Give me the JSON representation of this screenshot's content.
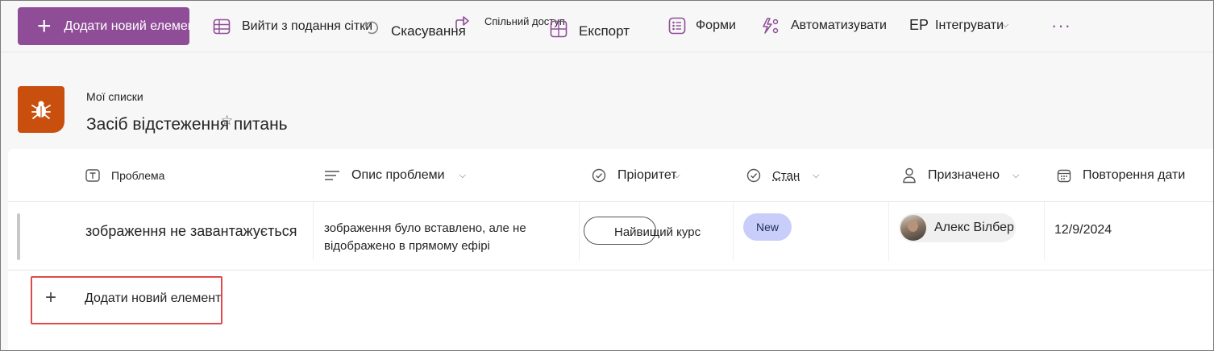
{
  "toolbar": {
    "add_new": "Додати новий елемент",
    "exit_grid": "Вийти з подання сітки",
    "undo": "Скасування",
    "share": "Спільний доступ",
    "export": "Експорт",
    "forms": "Форми",
    "automate": "Автоматизувати",
    "integrate_prefix": "EP",
    "integrate": "Інтегрувати",
    "more": "···"
  },
  "header": {
    "breadcrumb": "Мої списки",
    "title": "Засіб відстеження питань",
    "icon": "bug-icon",
    "icon_color": "#c94f0e"
  },
  "columns": [
    {
      "label": "Проблема",
      "icon": "text-type-icon"
    },
    {
      "label": "Опис проблеми",
      "icon": "text-lines-icon"
    },
    {
      "label": "Пріоритет",
      "icon": "check-circle-icon"
    },
    {
      "label": "Стан",
      "icon": "check-circle-icon"
    },
    {
      "label": "Призначено",
      "icon": "person-icon"
    },
    {
      "label": "Повторення дати",
      "icon": "calendar-icon"
    }
  ],
  "rows": [
    {
      "problem": "зображення не завантажується",
      "description": "зображення було вставлено, але не відображено в прямому ефірі",
      "priority": "Найвищий курс",
      "status": "New",
      "assigned": "Алекс Вілбер",
      "date": "12/9/2024"
    }
  ],
  "add_row": {
    "label": "Додати новий елемент"
  },
  "colors": {
    "accent": "#8f4d97",
    "status_new": "#c8cef9",
    "highlight": "#e04a4a"
  }
}
